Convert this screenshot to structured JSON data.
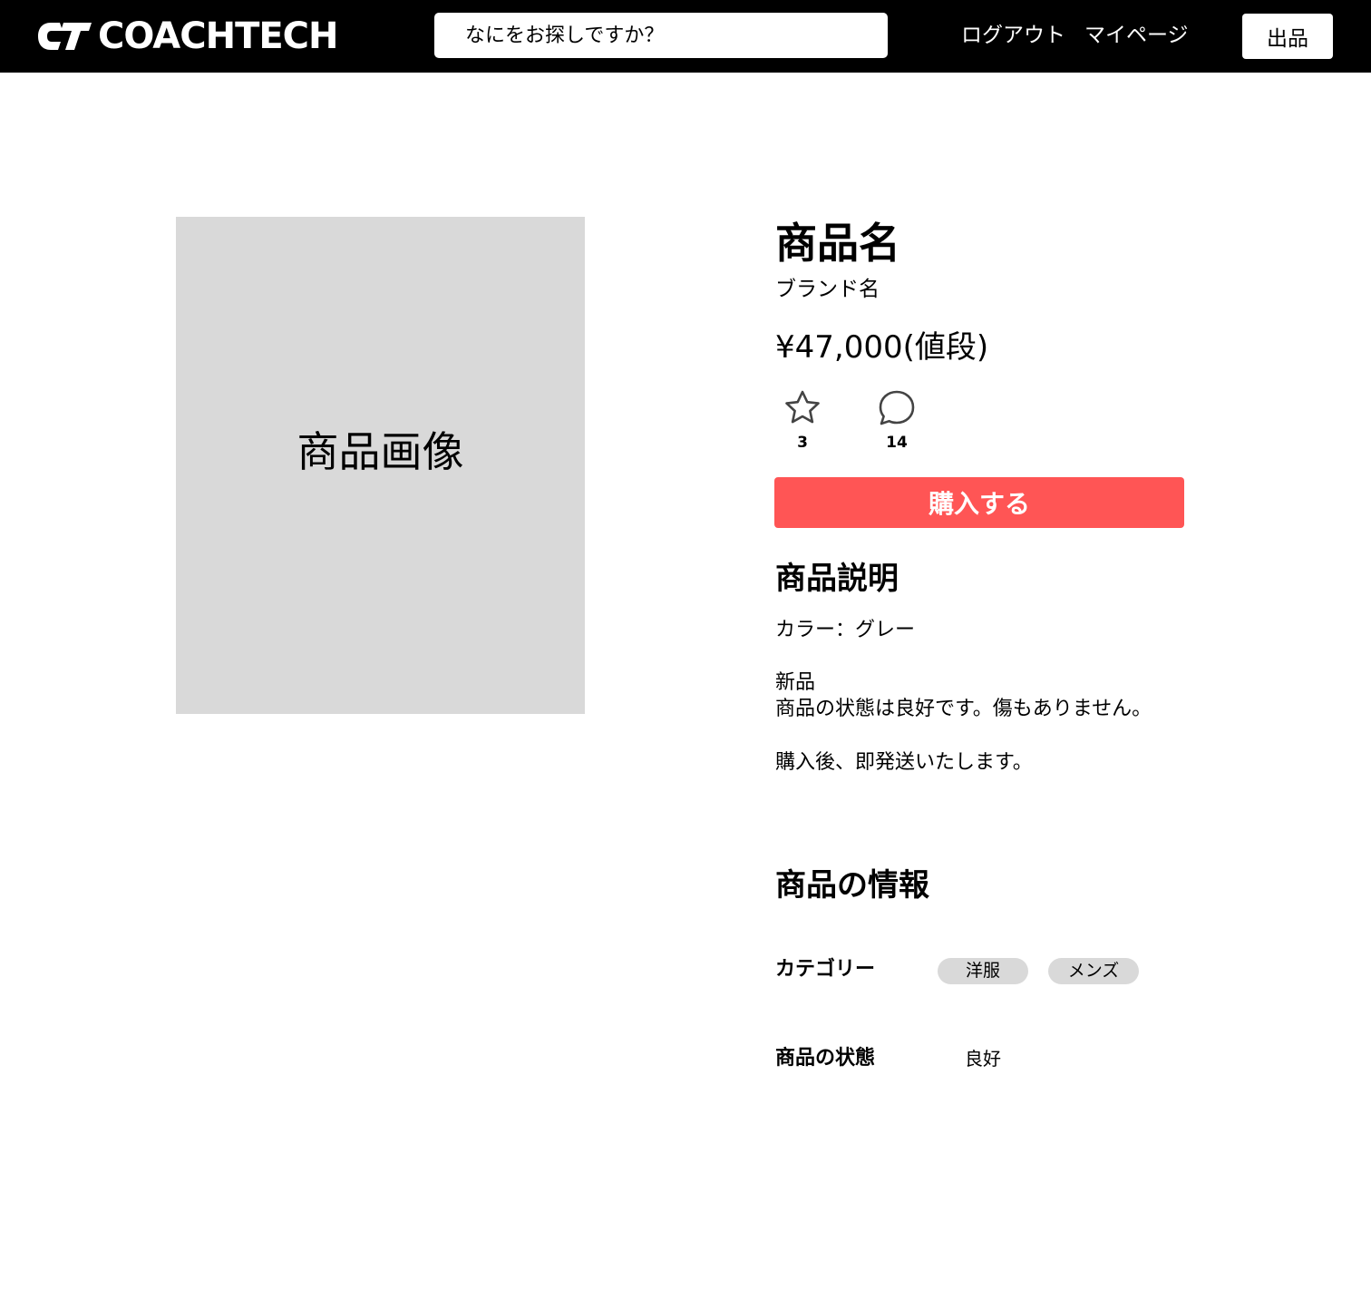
{
  "header": {
    "logo_text": "COACHTECH",
    "logo_mark": "CT",
    "search_placeholder": "なにをお探しですか？",
    "logout_label": "ログアウト",
    "mypage_label": "マイページ",
    "sell_label": "出品"
  },
  "product": {
    "image_label": "商品画像",
    "name": "商品名",
    "brand": "ブランド名",
    "price": "¥47,000(値段)",
    "likes": "3",
    "comments": "14",
    "buy_label": "購入する"
  },
  "description": {
    "title": "商品説明",
    "color_line": "カラー：グレー",
    "new_line": "新品",
    "state_line": "商品の状態は良好です。傷もありません。",
    "ship_line": "購入後、即発送いたします。"
  },
  "info": {
    "title": "商品の情報",
    "category_label": "カテゴリー",
    "categories": [
      "洋服",
      "メンズ"
    ],
    "condition_label": "商品の状態",
    "condition_value": "良好"
  },
  "icons": {
    "like": "star-icon",
    "comment": "comment-bubble-icon"
  },
  "colors": {
    "header_bg": "#000000",
    "buy_button": "#ff5555",
    "image_placeholder": "#d9d9d9",
    "tag_bg": "#d9d9d9"
  }
}
